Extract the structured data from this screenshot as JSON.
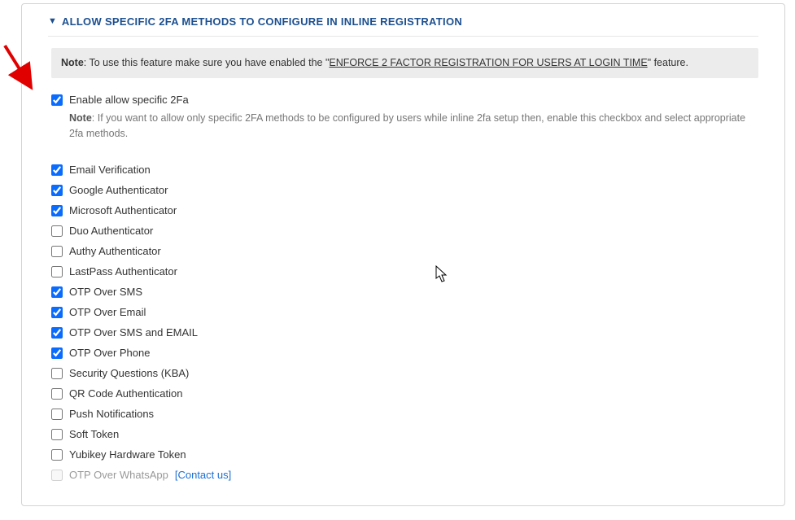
{
  "header": {
    "title": "ALLOW SPECIFIC 2FA METHODS TO CONFIGURE IN INLINE REGISTRATION"
  },
  "noteBar": {
    "noteLabel": "Note",
    "prefix": ": To use this feature make sure you have enabled the \"",
    "link": "ENFORCE 2 FACTOR REGISTRATION FOR USERS AT LOGIN TIME",
    "suffix": "\" feature."
  },
  "enable": {
    "checked": true,
    "label": "Enable allow specific 2Fa",
    "noteLabel": "Note",
    "noteText": ": If you want to allow only specific 2FA methods to be configured by users while inline 2fa setup then, enable this checkbox and select appropriate 2fa methods."
  },
  "methods": [
    {
      "label": "Email Verification",
      "checked": true,
      "disabled": false
    },
    {
      "label": "Google Authenticator",
      "checked": true,
      "disabled": false
    },
    {
      "label": "Microsoft Authenticator",
      "checked": true,
      "disabled": false
    },
    {
      "label": "Duo Authenticator",
      "checked": false,
      "disabled": false
    },
    {
      "label": "Authy Authenticator",
      "checked": false,
      "disabled": false
    },
    {
      "label": "LastPass Authenticator",
      "checked": false,
      "disabled": false
    },
    {
      "label": "OTP Over SMS",
      "checked": true,
      "disabled": false
    },
    {
      "label": "OTP Over Email",
      "checked": true,
      "disabled": false
    },
    {
      "label": "OTP Over SMS and EMAIL",
      "checked": true,
      "disabled": false
    },
    {
      "label": "OTP Over Phone",
      "checked": true,
      "disabled": false
    },
    {
      "label": "Security Questions (KBA)",
      "checked": false,
      "disabled": false
    },
    {
      "label": "QR Code Authentication",
      "checked": false,
      "disabled": false
    },
    {
      "label": "Push Notifications",
      "checked": false,
      "disabled": false
    },
    {
      "label": "Soft Token",
      "checked": false,
      "disabled": false
    },
    {
      "label": "Yubikey Hardware Token",
      "checked": false,
      "disabled": false
    },
    {
      "label": "OTP Over WhatsApp",
      "checked": false,
      "disabled": true,
      "extraLink": "[Contact us]"
    }
  ]
}
